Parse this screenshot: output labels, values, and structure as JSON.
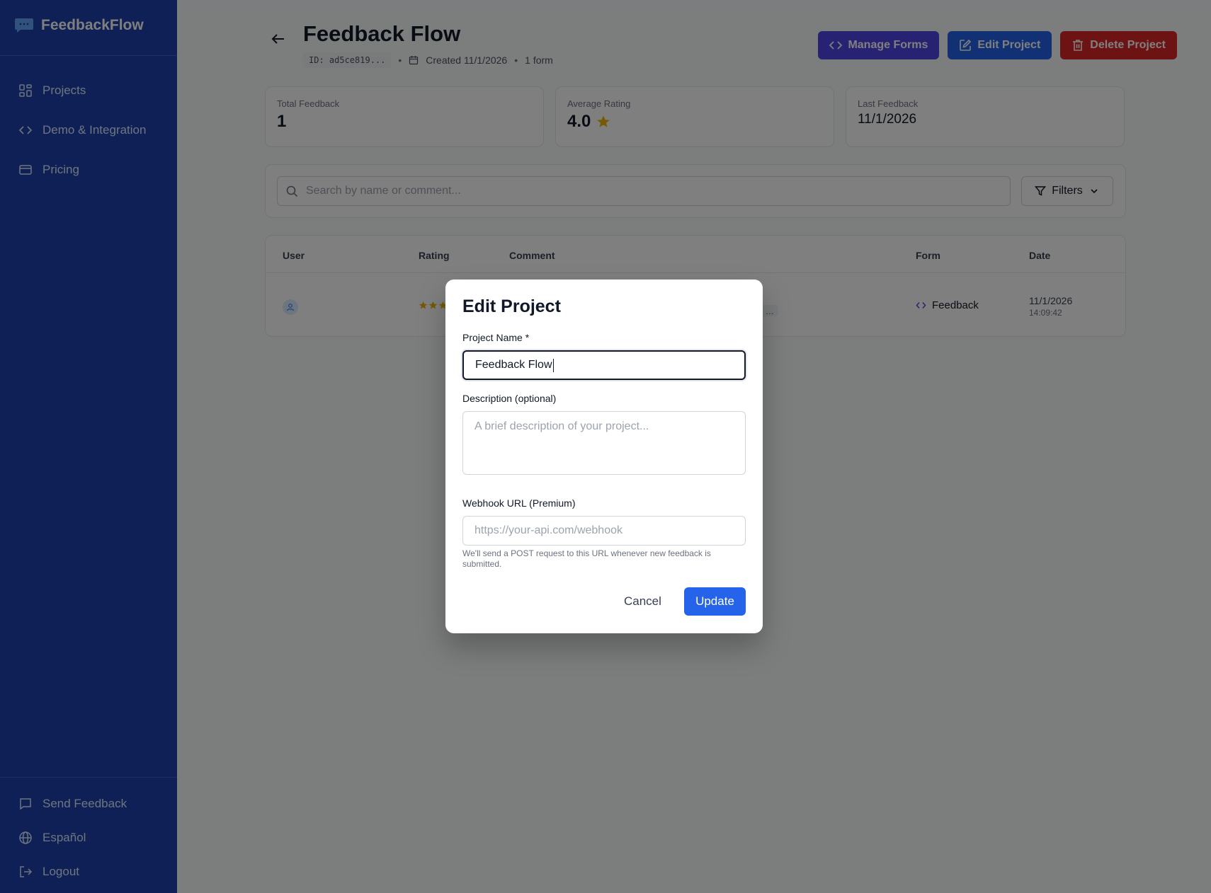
{
  "app": {
    "name": "FeedbackFlow"
  },
  "sidebar": {
    "items": [
      {
        "label": "Projects",
        "icon": "grid-icon"
      },
      {
        "label": "Demo & Integration",
        "icon": "code-icon"
      },
      {
        "label": "Pricing",
        "icon": "credit-card-icon"
      }
    ],
    "bottom_items": [
      {
        "label": "Send Feedback",
        "icon": "message-square-icon"
      },
      {
        "label": "Español",
        "icon": "globe-icon"
      },
      {
        "label": "Logout",
        "icon": "logout-icon"
      }
    ]
  },
  "header": {
    "title": "Feedback Flow",
    "project_id": "ID: ad5ce819...",
    "created": "Created 11/1/2026",
    "forms_count": "1 form",
    "manage_forms": "Manage Forms",
    "edit_project": "Edit Project",
    "delete_project": "Delete Project"
  },
  "stats": {
    "total_label": "Total Feedback",
    "total_value": "1",
    "avg_label": "Average Rating",
    "avg_value": "4.0",
    "last_label": "Last Feedback",
    "last_value": "11/1/2026"
  },
  "search": {
    "placeholder": "Search by name or comment...",
    "filters_label": "Filters"
  },
  "table": {
    "columns": [
      "User",
      "Rating",
      "Comment",
      "Form",
      "Date"
    ],
    "rows": [
      {
        "rating": 4,
        "comment_hint": "...",
        "form": "Feedback",
        "date": "11/1/2026",
        "time": "14:09:42"
      }
    ]
  },
  "modal": {
    "title": "Edit Project",
    "name_label": "Project Name *",
    "name_value": "Feedback Flow",
    "description_label": "Description (optional)",
    "description_placeholder": "A brief description of your project...",
    "webhook_label": "Webhook URL (Premium)",
    "webhook_placeholder": "https://your-api.com/webhook",
    "webhook_help": "We'll send a POST request to this URL whenever new feedback is submitted.",
    "cancel": "Cancel",
    "update": "Update"
  },
  "colors": {
    "sidebar": "#1e40af",
    "primary": "#2563eb",
    "indigo": "#4f46e5",
    "danger": "#dc2626",
    "star": "#eab308"
  }
}
